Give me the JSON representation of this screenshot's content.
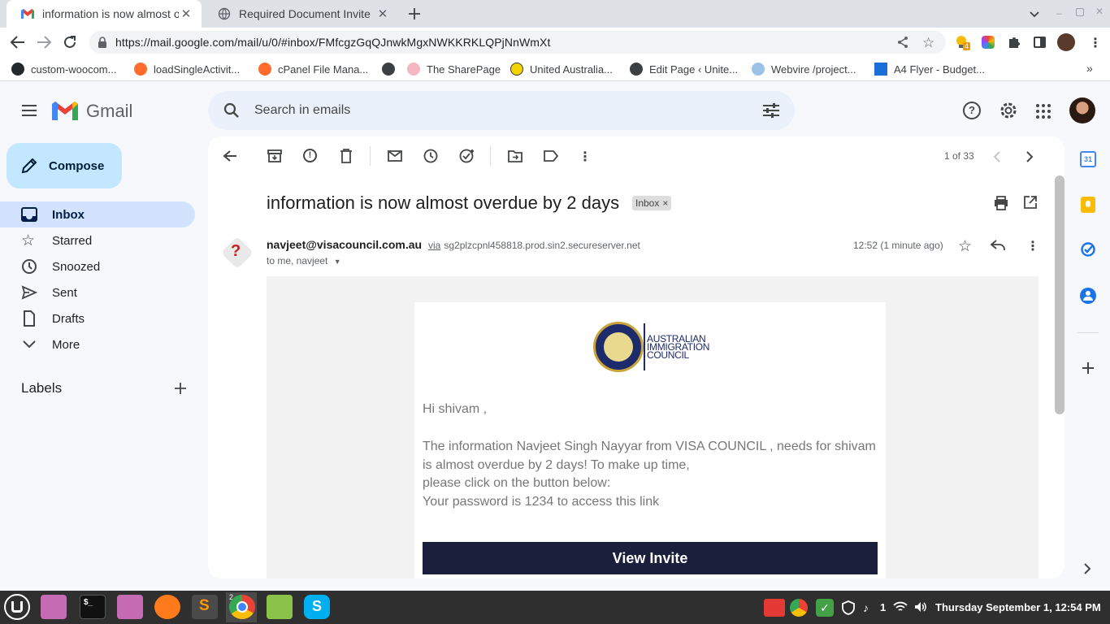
{
  "browser": {
    "tabs": [
      {
        "title": "information is now almost ove",
        "active": true
      },
      {
        "title": "Required Document Invite",
        "active": false
      }
    ],
    "url": "https://mail.google.com/mail/u/0/#inbox/FMfcgzGqQJnwkMgxNWKKRKLQPjNnWmXt",
    "extension_badge": "4",
    "bookmarks": [
      "custom-woocom...",
      "loadSingleActivit...",
      "cPanel File Mana...",
      "The SharePage",
      "United Australia...",
      "Edit Page ‹ Unite...",
      "Webvire /project...",
      "A4 Flyer - Budget..."
    ],
    "bookmarks_overflow": "»"
  },
  "gmail": {
    "brand": "Gmail",
    "search_placeholder": "Search in emails",
    "compose_label": "Compose",
    "nav": [
      {
        "label": "Inbox",
        "icon": "inbox-icon",
        "active": true
      },
      {
        "label": "Starred",
        "icon": "star-icon",
        "active": false
      },
      {
        "label": "Snoozed",
        "icon": "clock-icon",
        "active": false
      },
      {
        "label": "Sent",
        "icon": "send-icon",
        "active": false
      },
      {
        "label": "Drafts",
        "icon": "draft-icon",
        "active": false
      },
      {
        "label": "More",
        "icon": "chevron-down-icon",
        "active": false
      }
    ],
    "labels_title": "Labels",
    "pager": "1 of 33",
    "calendar_day": "31"
  },
  "email": {
    "subject": "information is now almost overdue by 2 days",
    "label_chip": "Inbox",
    "label_chip_close": "×",
    "sender": "navjeet@visacouncil.com.au",
    "via_word": "via",
    "via_server": "sg2plzcpnl458818.prod.sin2.secureserver.net",
    "to_line": "to me, navjeet",
    "time": "12:52 (1 minute ago)",
    "logo_text": [
      "AUSTRALIAN",
      "IMMIGRATION",
      "COUNCIL"
    ],
    "greeting": "Hi shivam ,",
    "body_lines": [
      "The information Navjeet Singh Nayyar from VISA COUNCIL , needs for shivam",
      "is almost overdue by 2 days! To make up time,",
      "please click on the button below:",
      "Your password is 1234 to access this link"
    ],
    "button_label": "View Invite"
  },
  "taskbar": {
    "chrome_window_count": "2",
    "notification_count": "1",
    "clock": "Thursday September  1, 12:54 PM"
  },
  "colors": {
    "accent": "#c2e7ff",
    "active_nav": "#d3e3fd",
    "invite_button": "#1b1f3b",
    "gmail_red": "#ea4335",
    "gmail_blue": "#4285f4",
    "gmail_yellow": "#fbbc04",
    "gmail_green": "#34a853"
  }
}
